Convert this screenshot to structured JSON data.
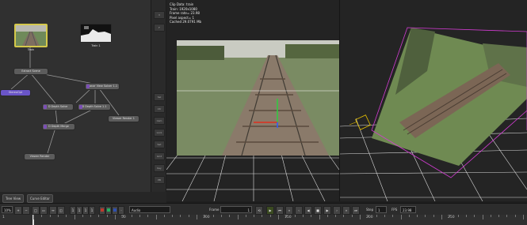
{
  "graph": {
    "thumbs": [
      {
        "label": "Train",
        "selected": true
      },
      {
        "label": "Train 1",
        "selected": false
      }
    ],
    "nodes": [
      {
        "label": "Extract Scene"
      },
      {
        "label": "StereoOpt"
      },
      {
        "label": "Planar View Solver 1.1"
      },
      {
        "label": "D Depth Solve"
      },
      {
        "label": "D Depth Solve 1.1"
      },
      {
        "label": "D Depth Merge"
      },
      {
        "label": "Viewer Render 1"
      },
      {
        "label": "Viewer Render"
      }
    ]
  },
  "sidebar": {
    "buttons": [
      "V",
      "F",
      "Sel",
      "Ctr",
      "Cam",
      "Lock",
      "Set",
      "Grid",
      "Key",
      "A",
      "3D",
      "PB"
    ]
  },
  "viewer1": {
    "info": [
      "Clip Data: train",
      "Train: 1920x1080",
      "Frame rate= 23.98",
      "Pixel aspect= 1",
      "Cached 29.0791 Mb"
    ]
  },
  "tabs": {
    "tree_view": "Tree View",
    "curve_editor": "Curve Editor"
  },
  "playback": {
    "zoom": "10%",
    "channel": "Audio",
    "frame_label": "Frame",
    "frame_value": "1",
    "step_label": "Step",
    "step_value": "1",
    "fps_label": "FPS",
    "fps_value": "23.98",
    "colors": {
      "red": "#c0392b",
      "green": "#27ae60",
      "blue": "#2e4fb0"
    }
  },
  "timeline": {
    "start": "1",
    "ticks": [
      "50",
      "100",
      "150",
      "200",
      "250"
    ]
  }
}
